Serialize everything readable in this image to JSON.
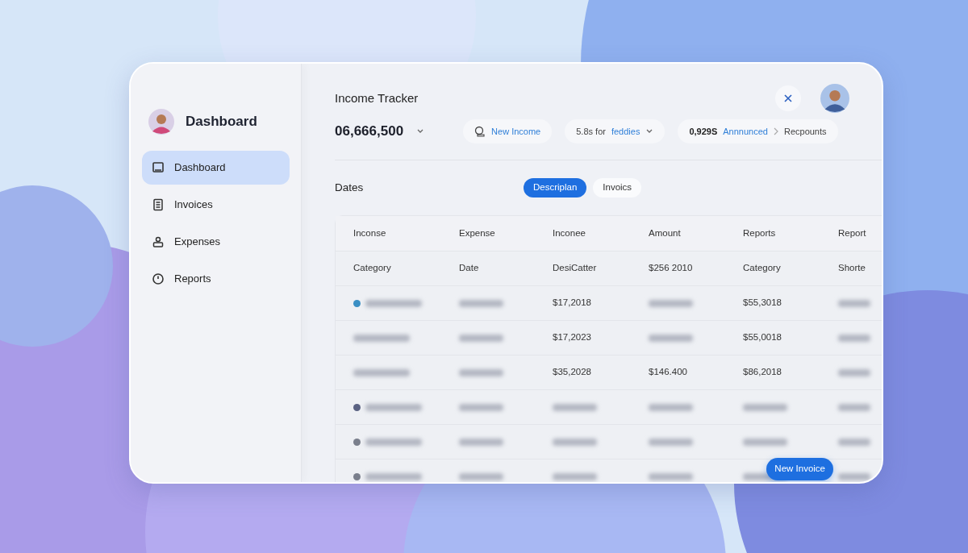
{
  "sidebar": {
    "brand": "Dashboard",
    "items": [
      {
        "label": "Dashboard",
        "kind": "monitor",
        "selected": true
      },
      {
        "label": "Invoices",
        "kind": "document",
        "selected": false
      },
      {
        "label": "Expenses",
        "kind": "person",
        "selected": false
      },
      {
        "label": "Reports",
        "kind": "clock",
        "selected": false
      }
    ]
  },
  "header": {
    "title": "Income Tracker",
    "amount": "06,666,500"
  },
  "pills": [
    {
      "kind": "action",
      "text": "New Income"
    },
    {
      "kind": "filter",
      "prefix": "5.8s for",
      "link": "feddies"
    },
    {
      "kind": "summary",
      "value": "0,929S",
      "link": "Annnunced",
      "trail": "Recpounts"
    }
  ],
  "section": {
    "title": "Dates",
    "tabs": [
      {
        "label": "Descriplan",
        "selected": true
      },
      {
        "label": "Invoics",
        "selected": false
      }
    ]
  },
  "table": {
    "columns": [
      "Inconse",
      "Expense",
      "Inconee",
      "Amount",
      "Reports",
      "Report"
    ],
    "rows": [
      {
        "cells": [
          {
            "text": "Category"
          },
          {
            "text": "Date"
          },
          {
            "text": "DesiCatter"
          },
          {
            "text": "$256 2010"
          },
          {
            "text": "Category"
          },
          {
            "text": "Shorte"
          }
        ]
      },
      {
        "color": "#3a8fc4",
        "cells": [
          {
            "kind": "blurred"
          },
          {
            "kind": "blurred"
          },
          {
            "text": "$17,2018"
          },
          {
            "kind": "blurred"
          },
          {
            "text": "$55,3018"
          },
          {
            "kind": "blurred"
          }
        ]
      },
      {
        "cells": [
          {
            "kind": "blurred"
          },
          {
            "kind": "blurred"
          },
          {
            "text": "$17,2023"
          },
          {
            "kind": "blurred"
          },
          {
            "text": "$55,0018"
          },
          {
            "kind": "blurred"
          }
        ]
      },
      {
        "cells": [
          {
            "kind": "blurred"
          },
          {
            "kind": "blurred"
          },
          {
            "text": "$35,2028"
          },
          {
            "text": "$146.400"
          },
          {
            "text": "$86,2018"
          },
          {
            "kind": "blurred"
          }
        ]
      },
      {
        "color": "#5a6282",
        "cells": [
          {
            "kind": "blurred"
          },
          {
            "kind": "blurred"
          },
          {
            "kind": "blurred"
          },
          {
            "kind": "blurred"
          },
          {
            "kind": "blurred"
          },
          {
            "kind": "blurred"
          }
        ]
      },
      {
        "color": "#7a7f8c",
        "cells": [
          {
            "kind": "blurred"
          },
          {
            "kind": "blurred"
          },
          {
            "kind": "blurred"
          },
          {
            "kind": "blurred"
          },
          {
            "kind": "blurred"
          },
          {
            "kind": "blurred"
          }
        ]
      },
      {
        "color": "#7a7f8c",
        "cells": [
          {
            "kind": "blurred"
          },
          {
            "kind": "blurred"
          },
          {
            "kind": "blurred"
          },
          {
            "kind": "blurred"
          },
          {
            "kind": "blurred"
          },
          {
            "kind": "blurred"
          }
        ]
      }
    ]
  },
  "fab": "New Invoice"
}
